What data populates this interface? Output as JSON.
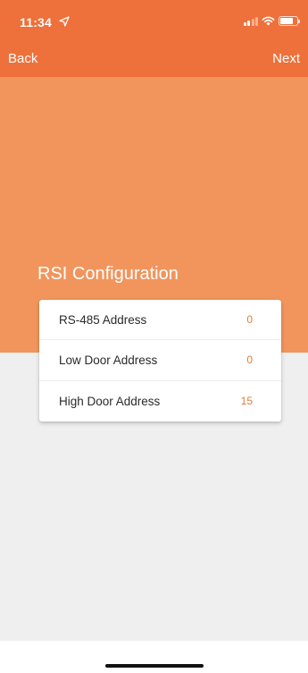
{
  "status_bar": {
    "time": "11:34",
    "location_icon": "location-arrow-icon",
    "signal_icon": "cellular-signal-icon",
    "wifi_icon": "wifi-icon",
    "battery_icon": "battery-icon"
  },
  "nav": {
    "back_label": "Back",
    "next_label": "Next"
  },
  "page": {
    "title": "RSI Configuration"
  },
  "config_rows": [
    {
      "label": "RS-485 Address",
      "value": "0"
    },
    {
      "label": "Low Door Address",
      "value": "0"
    },
    {
      "label": "High Door Address",
      "value": "15"
    }
  ],
  "colors": {
    "header": "#ee703a",
    "hero": "#f1955d",
    "accent_value": "#e07b38",
    "background": "#efefef"
  }
}
